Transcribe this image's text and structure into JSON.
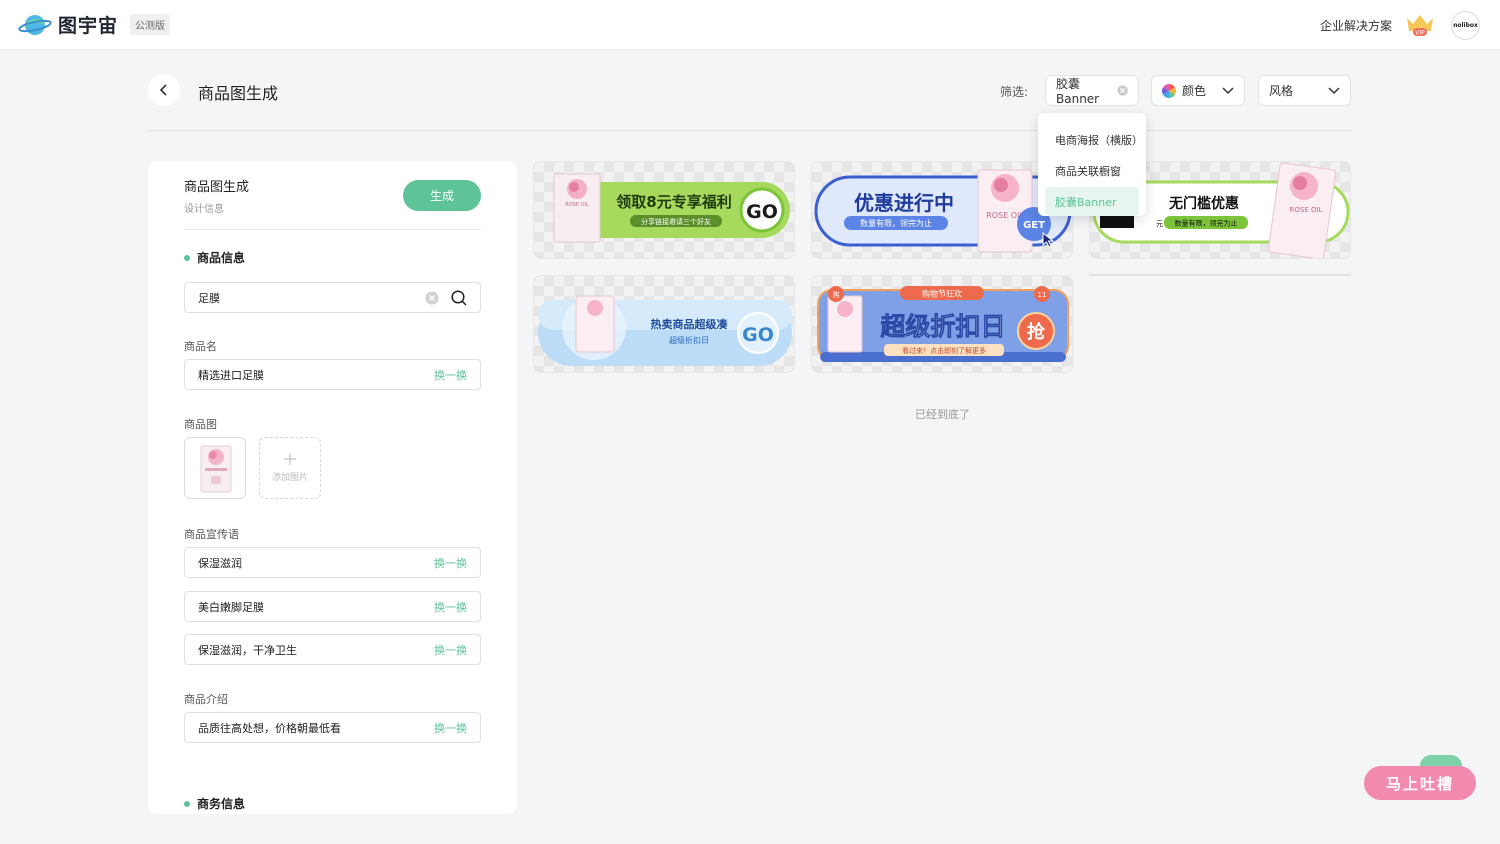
{
  "header": {
    "app_name": "图宇宙",
    "beta_badge": "公测版",
    "enterprise_link": "企业解决方案",
    "vip_badge": "VIP",
    "avatar_text": "nolibox"
  },
  "page": {
    "title": "商品图生成",
    "filter_label": "筛选:",
    "filters": {
      "type_value": "胶囊Banner",
      "color_label": "颜色",
      "style_label": "风格"
    },
    "dropdown": {
      "options": [
        "电商海报（横版）",
        "商品关联橱窗",
        "胶囊Banner"
      ],
      "selected": "胶囊Banner"
    },
    "end_note": "已经到底了"
  },
  "panel": {
    "title": "商品图生成",
    "subtitle": "设计信息",
    "generate_button": "生成",
    "section_product": "商品信息",
    "search_value": "足膜",
    "name_label": "商品名",
    "name_value": "精选进口足膜",
    "swap_label": "换一换",
    "image_label": "商品图",
    "add_image_label": "添加图片",
    "slogan_label": "商品宣传语",
    "slogans": [
      "保湿滋润",
      "美白嫩脚足膜",
      "保湿滋润，干净卫生"
    ],
    "intro_label": "商品介绍",
    "intro_value": "品质往高处想，价格朝最低看",
    "section_business": "商务信息"
  },
  "banners": {
    "b1": {
      "title": "领取8元专享福利",
      "sub": "分享链接邀请三个好友",
      "cta": "GO"
    },
    "b2": {
      "title": "优惠进行中",
      "sub": "数量有限，领完为止",
      "cta": "GET"
    },
    "b3": {
      "title": "无门槛优惠",
      "sub": "数量有限，领完为止",
      "unit": "元"
    },
    "b4": {
      "title": "热卖商品超级凑",
      "sub": "超级折扣日",
      "cta": "GO"
    },
    "b5": {
      "tag": "购物节狂欢",
      "title": "超级折扣日",
      "sub": "看过来！点击即刻了解更多",
      "cta": "抢",
      "corner_left": "购",
      "corner_right": "11"
    },
    "pack_label": "ROSE OIL"
  },
  "feedback": {
    "label": "马上吐槽"
  },
  "colors": {
    "accent": "#5fc39a",
    "feedback": "#f28ab0"
  }
}
